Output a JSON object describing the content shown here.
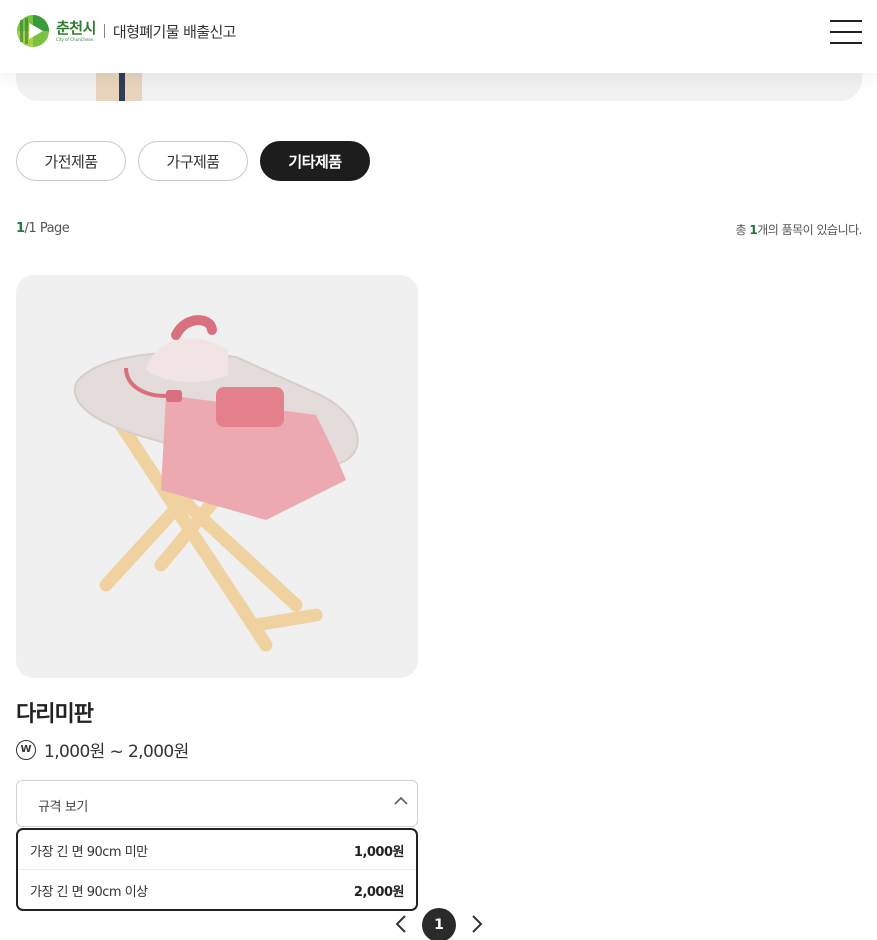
{
  "header": {
    "city_name": "춘천시",
    "city_sub": "City of ChunCheon",
    "service_title": "대형폐기물 배출신고"
  },
  "tabs": [
    {
      "label": "가전제품",
      "active": false
    },
    {
      "label": "가구제품",
      "active": false
    },
    {
      "label": "기타제품",
      "active": true
    }
  ],
  "page_info": {
    "current": "1",
    "rest": "/1 Page"
  },
  "count_info": {
    "prefix": "총 ",
    "count": "1",
    "suffix": "개의 품목이 있습니다."
  },
  "product": {
    "name": "다리미판",
    "currency_symbol": "W",
    "price_range": "1,000원 ~ 2,000원",
    "spec_toggle_label": "규격 보기",
    "specs": [
      {
        "label": "가장 긴 면 90cm 미만",
        "price": "1,000원"
      },
      {
        "label": "가장 긴 면 90cm 이상",
        "price": "2,000원"
      }
    ]
  },
  "pagination": {
    "current_page": "1"
  },
  "colors": {
    "accent_green": "#1e7b3a",
    "active_tab": "#1d1d1d"
  }
}
